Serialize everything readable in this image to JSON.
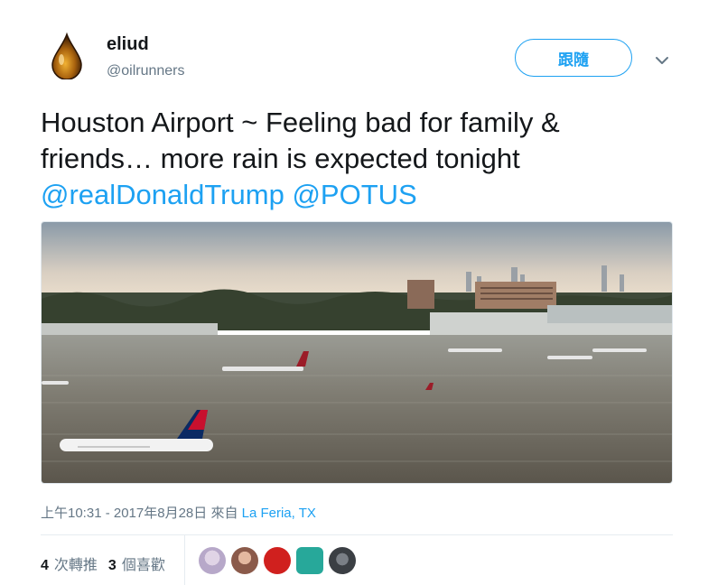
{
  "author": {
    "name": "eliud",
    "handle": "@oilrunners",
    "avatar_icon": "oil-drop-icon"
  },
  "follow_button": {
    "label": "跟隨"
  },
  "menu_icon": "chevron-down-icon",
  "tweet": {
    "text": "Houston Airport ~ Feeling bad for family & friends… more rain is expected tonight",
    "mentions": [
      "@realDonaldTrump",
      "@POTUS"
    ]
  },
  "photo": {
    "subject": "flooded-airport-photo"
  },
  "meta": {
    "timestamp": "上午10:31 - 2017年8月28日",
    "from_label": "來自",
    "location": "La Feria, TX"
  },
  "stats": {
    "retweets_count": "4",
    "retweets_label": "次轉推",
    "likes_count": "3",
    "likes_label": "個喜歡"
  },
  "likers": [
    {
      "name": "liker-avatar-1",
      "color": "#b7a8c9"
    },
    {
      "name": "liker-avatar-2",
      "color": "#8b5a4a"
    },
    {
      "name": "liker-avatar-3",
      "color": "#d0201e"
    },
    {
      "name": "liker-avatar-4",
      "color": "#27a89a"
    },
    {
      "name": "liker-avatar-5",
      "color": "#3b3f44"
    }
  ],
  "colors": {
    "accent": "#1da1f2",
    "secondary_text": "#657786"
  }
}
